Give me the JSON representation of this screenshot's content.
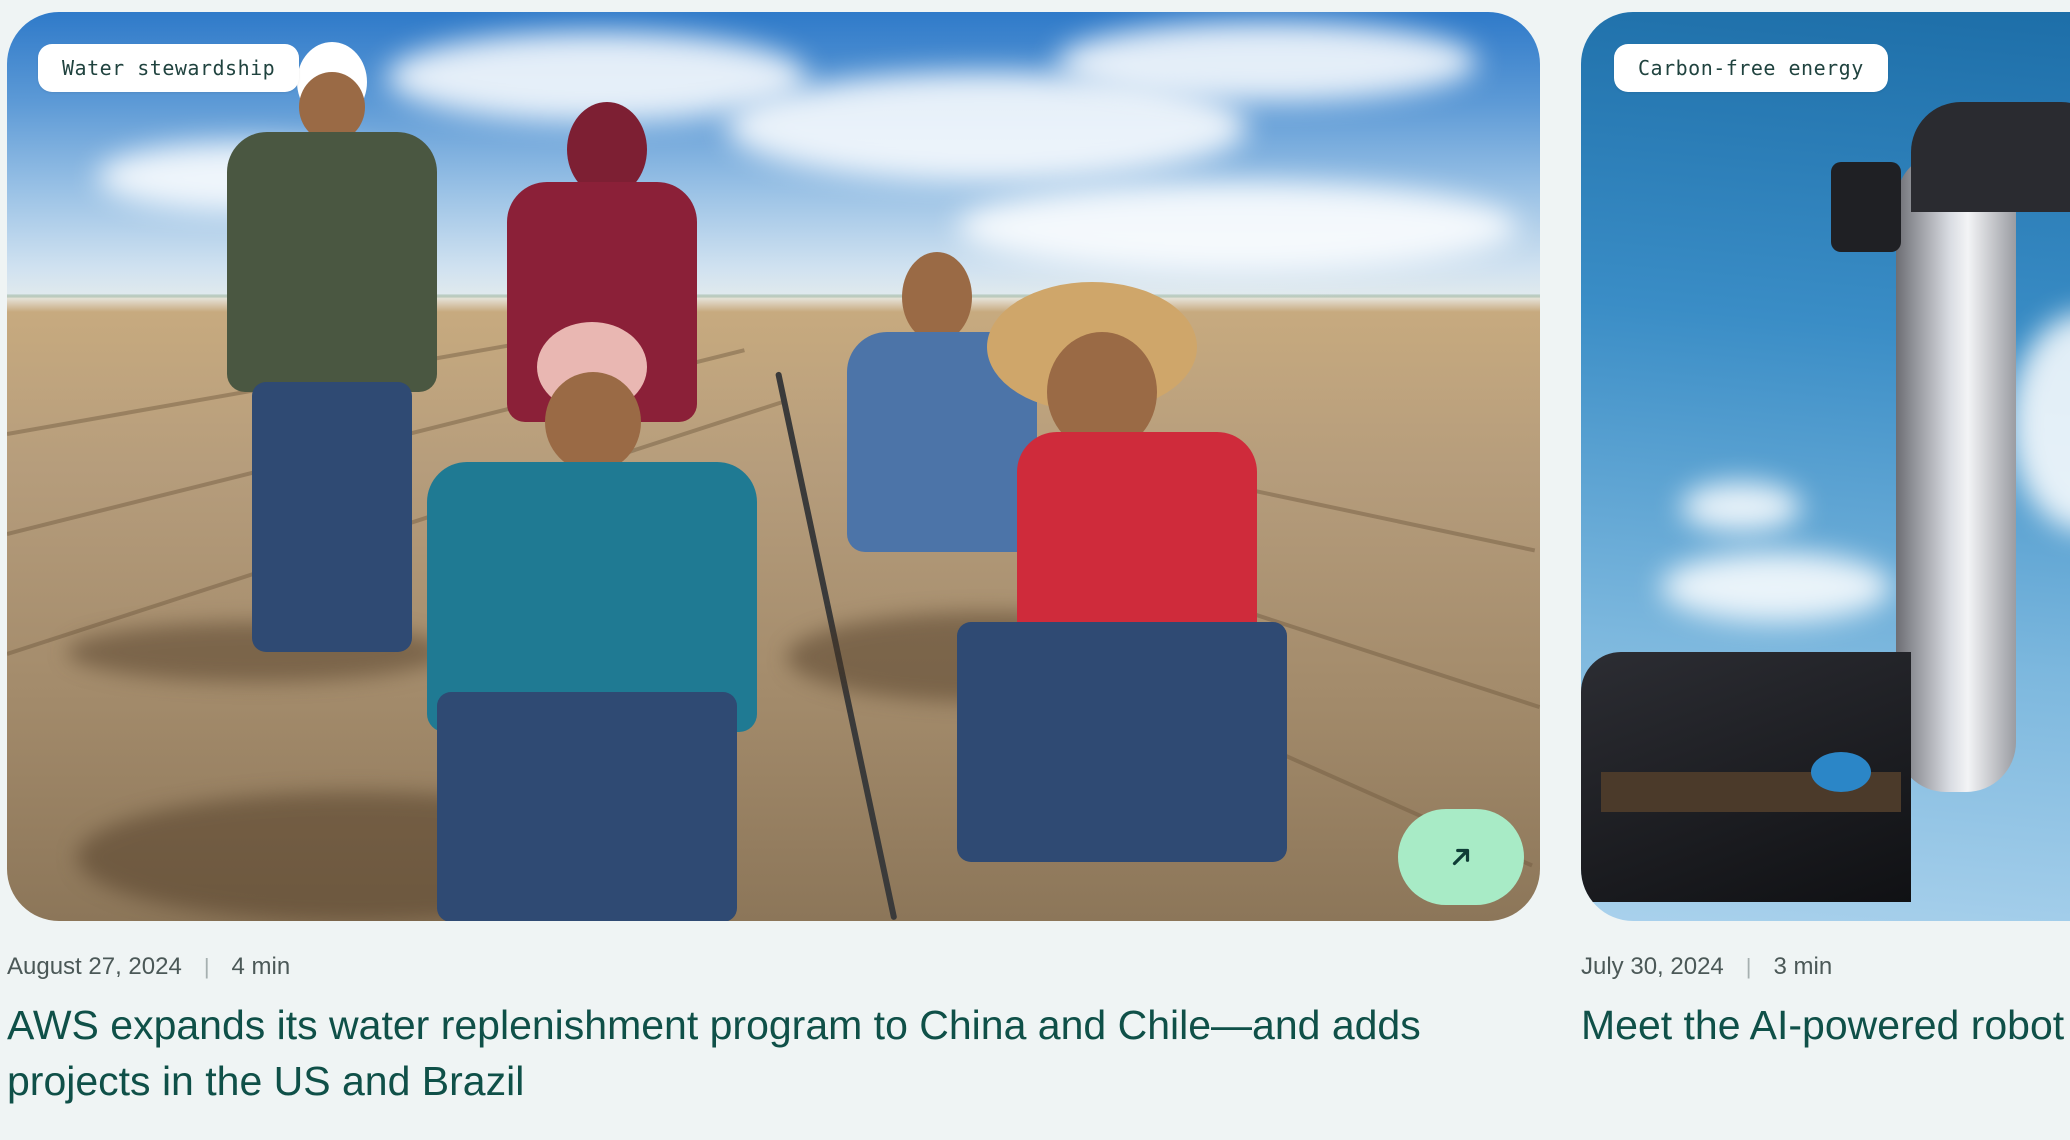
{
  "cards": [
    {
      "tag": "Water stewardship",
      "date": "August 27, 2024",
      "read_time": "4 min",
      "title": "AWS expands its water replenishment program to China and Chile—and adds projects in the US and Brazil",
      "image": "photo of farm workers in a field with drip irrigation hose",
      "action_icon": "arrow-up-right-icon"
    },
    {
      "tag": "Carbon-free energy",
      "date": "July 30, 2024",
      "read_time": "3 min",
      "title": "Meet the AI-powered robot",
      "image": "photo of a robotic arm against a blue sky"
    }
  ],
  "colors": {
    "page_background": "#eff4f4",
    "title_text": "#0f5048",
    "action_button": "#a8ebc6"
  }
}
